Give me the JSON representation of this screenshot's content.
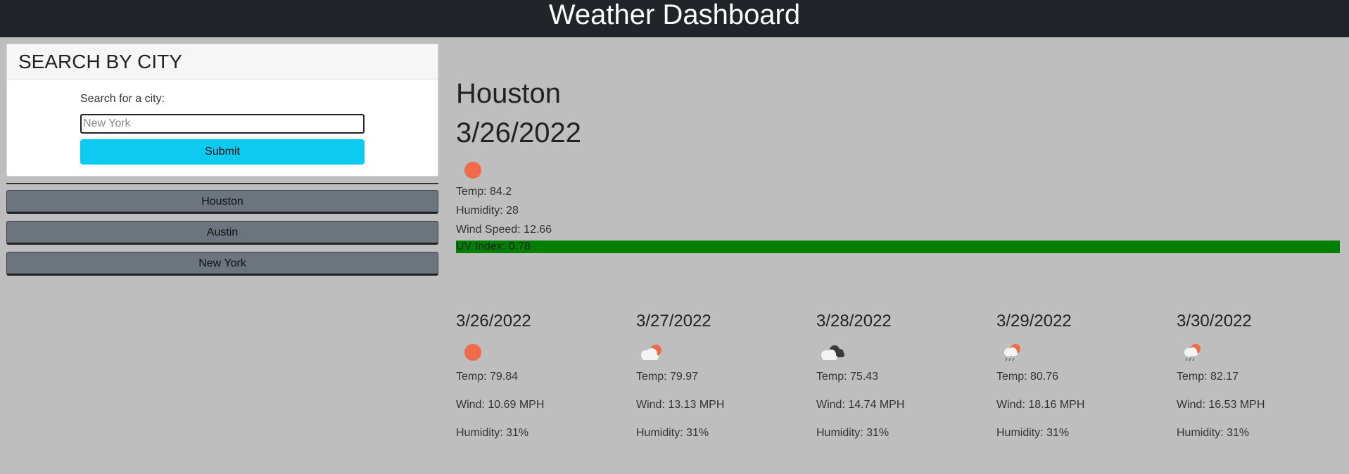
{
  "header": {
    "title": "Weather Dashboard"
  },
  "search": {
    "heading": "SEARCH BY CITY",
    "label": "Search for a city:",
    "placeholder": "New York",
    "submit_label": "Submit"
  },
  "history": [
    "Houston",
    "Austin",
    "New York"
  ],
  "current": {
    "city": "Houston",
    "date": "3/26/2022",
    "icon": "sun-icon",
    "temp": "Temp: 84.2",
    "humidity": "Humidity: 28",
    "wind": "Wind Speed: 12.66",
    "uv": "UV Index: 0.78",
    "uv_color": "#008000"
  },
  "forecast": [
    {
      "date": "3/26/2022",
      "icon": "sun-icon",
      "temp": "Temp: 79.84",
      "wind": "Wind: 10.69 MPH",
      "humidity": "Humidity: 31%"
    },
    {
      "date": "3/27/2022",
      "icon": "partly-cloudy-icon",
      "temp": "Temp: 79.97",
      "wind": "Wind: 13.13 MPH",
      "humidity": "Humidity: 31%"
    },
    {
      "date": "3/28/2022",
      "icon": "dark-clouds-icon",
      "temp": "Temp: 75.43",
      "wind": "Wind: 14.74 MPH",
      "humidity": "Humidity: 31%"
    },
    {
      "date": "3/29/2022",
      "icon": "rain-sun-icon",
      "temp": "Temp: 80.76",
      "wind": "Wind: 18.16 MPH",
      "humidity": "Humidity: 31%"
    },
    {
      "date": "3/30/2022",
      "icon": "rain-sun-icon",
      "temp": "Temp: 82.17",
      "wind": "Wind: 16.53 MPH",
      "humidity": "Humidity: 31%"
    }
  ],
  "colors": {
    "header_bg": "#212529",
    "submit_bg": "#0dcaf0",
    "history_bg": "#6c757d",
    "sun": "#ef6b4a"
  }
}
